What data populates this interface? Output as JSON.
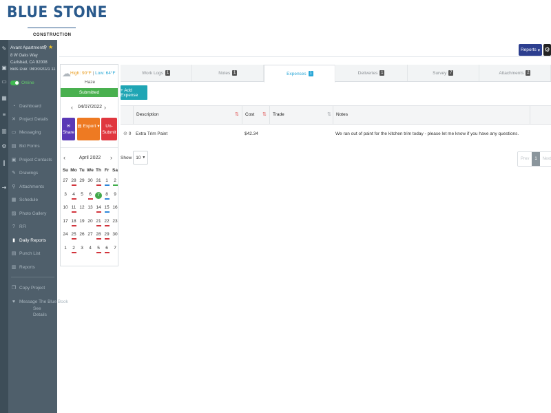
{
  "logo": {
    "main": "BLUE STONE",
    "sub": "CONSTRUCTION"
  },
  "project": {
    "name": "Avant Apartments",
    "address1": "8 W Oaks Way",
    "address2": "Carlsbad, CA 92008",
    "bids_due": "Bids Due: 08/30/2021 11...",
    "status": "Online"
  },
  "sidebar": {
    "items": [
      {
        "label": "Dashboard",
        "icon": "dashboard-icon",
        "glyph": "◔"
      },
      {
        "label": "Project Details",
        "icon": "details-icon",
        "glyph": "✕"
      },
      {
        "label": "Messaging",
        "icon": "messaging-icon",
        "glyph": "▭"
      },
      {
        "label": "Bid Forms",
        "icon": "bid-forms-icon",
        "glyph": "▤"
      },
      {
        "label": "Project Contacts",
        "icon": "contacts-icon",
        "glyph": "▣"
      },
      {
        "label": "Drawings",
        "icon": "drawings-icon",
        "glyph": "✎"
      },
      {
        "label": "Attachments",
        "icon": "attachments-icon",
        "glyph": "⚲"
      },
      {
        "label": "Schedule",
        "icon": "schedule-icon",
        "glyph": "▦"
      },
      {
        "label": "Photo Gallery",
        "icon": "photo-icon",
        "glyph": "▨"
      },
      {
        "label": "RFI",
        "icon": "rfi-icon",
        "glyph": "?"
      },
      {
        "label": "Daily Reports",
        "icon": "daily-reports-icon",
        "glyph": "▮"
      },
      {
        "label": "Punch List",
        "icon": "punch-list-icon",
        "glyph": "▤"
      },
      {
        "label": "Reports",
        "icon": "reports-icon",
        "glyph": "▥"
      },
      {
        "label": "Copy Project",
        "icon": "copy-icon",
        "glyph": "❐"
      },
      {
        "label": "Message The Blue Book",
        "icon": "heart-icon",
        "glyph": "♥"
      },
      {
        "label": "See",
        "icon": "",
        "glyph": ""
      },
      {
        "label": "Details",
        "icon": "",
        "glyph": ""
      }
    ],
    "active_label": "Daily Reports"
  },
  "toolbar": {
    "reports_label": "Reports"
  },
  "weather": {
    "high": "High: 90°F",
    "low": "Low: 64°F",
    "condition": "Haze"
  },
  "report": {
    "status": "Submitted",
    "date": "04/07/2022",
    "share_label": "Share",
    "export_label": "Export",
    "unsubmit_line1": "Un-",
    "unsubmit_line2": "Submit"
  },
  "calendar": {
    "month_label": "April 2022",
    "dow": [
      "Su",
      "Mo",
      "Tu",
      "We",
      "Th",
      "Fr",
      "Sa"
    ],
    "weeks": [
      [
        {
          "d": "27",
          "m": ""
        },
        {
          "d": "28",
          "m": "red"
        },
        {
          "d": "29",
          "m": ""
        },
        {
          "d": "30",
          "m": ""
        },
        {
          "d": "31",
          "m": "red"
        },
        {
          "d": "1",
          "m": "blue"
        },
        {
          "d": "2",
          "m": "green"
        }
      ],
      [
        {
          "d": "3",
          "m": ""
        },
        {
          "d": "4",
          "m": "red"
        },
        {
          "d": "5",
          "m": ""
        },
        {
          "d": "6",
          "m": "red"
        },
        {
          "d": "7",
          "m": "today"
        },
        {
          "d": "8",
          "m": "blue"
        },
        {
          "d": "9",
          "m": ""
        }
      ],
      [
        {
          "d": "10",
          "m": ""
        },
        {
          "d": "11",
          "m": "red"
        },
        {
          "d": "12",
          "m": ""
        },
        {
          "d": "13",
          "m": ""
        },
        {
          "d": "14",
          "m": "red"
        },
        {
          "d": "15",
          "m": "blue"
        },
        {
          "d": "16",
          "m": ""
        }
      ],
      [
        {
          "d": "17",
          "m": ""
        },
        {
          "d": "18",
          "m": "red"
        },
        {
          "d": "19",
          "m": ""
        },
        {
          "d": "20",
          "m": ""
        },
        {
          "d": "21",
          "m": "red"
        },
        {
          "d": "22",
          "m": "red"
        },
        {
          "d": "23",
          "m": ""
        }
      ],
      [
        {
          "d": "24",
          "m": ""
        },
        {
          "d": "25",
          "m": "red"
        },
        {
          "d": "26",
          "m": ""
        },
        {
          "d": "27",
          "m": ""
        },
        {
          "d": "28",
          "m": "red"
        },
        {
          "d": "29",
          "m": "red"
        },
        {
          "d": "30",
          "m": ""
        }
      ],
      [
        {
          "d": "1",
          "m": ""
        },
        {
          "d": "2",
          "m": "red"
        },
        {
          "d": "3",
          "m": ""
        },
        {
          "d": "4",
          "m": ""
        },
        {
          "d": "5",
          "m": "red"
        },
        {
          "d": "6",
          "m": "red"
        },
        {
          "d": "7",
          "m": ""
        }
      ]
    ]
  },
  "tabs": [
    {
      "label": "Work Logs",
      "count": "1",
      "active": false
    },
    {
      "label": "Notes",
      "count": "1",
      "active": false
    },
    {
      "label": "Expenses",
      "count": "1",
      "active": true
    },
    {
      "label": "Deliveries",
      "count": "1",
      "active": false
    },
    {
      "label": "Survey",
      "count": "7",
      "active": false
    },
    {
      "label": "Attachments",
      "count": "2",
      "active": false
    }
  ],
  "expenses": {
    "add_label": "+ Add Expense",
    "columns": [
      "Description",
      "Cost",
      "Trade",
      "Notes"
    ],
    "rows": [
      {
        "attachments": "0",
        "description": "Extra Trim Paint",
        "cost": "$42.34",
        "trade": "",
        "notes": "We ran out of paint for the kitchen trim today - please let me know if you have any questions."
      }
    ],
    "show_label": "Show",
    "page_size": "10",
    "pager": {
      "prev": "Prev",
      "page": "1",
      "next": "Next"
    }
  },
  "colors": {
    "brand": "#2a5a8c",
    "accent": "#2aa7d7",
    "submitted": "#49b04f",
    "share": "#5a39b6",
    "export": "#ee7a22",
    "unsubmit": "#e0373f",
    "add": "#1fa5b4"
  }
}
